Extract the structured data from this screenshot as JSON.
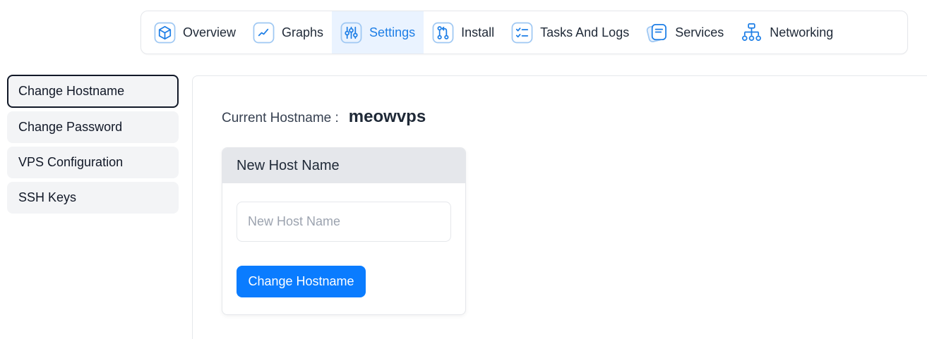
{
  "tabs": [
    {
      "label": "Overview",
      "icon": "cube-icon"
    },
    {
      "label": "Graphs",
      "icon": "graph-icon"
    },
    {
      "label": "Settings",
      "icon": "sliders-icon"
    },
    {
      "label": "Install",
      "icon": "git-pull-request-icon"
    },
    {
      "label": "Tasks And Logs",
      "icon": "checklist-icon"
    },
    {
      "label": "Services",
      "icon": "cards-icon"
    },
    {
      "label": "Networking",
      "icon": "network-icon"
    }
  ],
  "active_tab": "Settings",
  "sidebar": {
    "items": [
      {
        "label": "Change Hostname"
      },
      {
        "label": "Change Password"
      },
      {
        "label": "VPS Configuration"
      },
      {
        "label": "SSH Keys"
      }
    ],
    "active": "Change Hostname"
  },
  "main": {
    "current_label": "Current Hostname :",
    "current_value": "meowvps",
    "card": {
      "title": "New Host Name",
      "input_placeholder": "New Host Name",
      "input_value": "",
      "button_label": "Change Hostname"
    }
  },
  "colors": {
    "accent": "#0a7cff",
    "icon_blue": "#1d7ee6",
    "active_tab_bg": "#eaf3ff"
  }
}
